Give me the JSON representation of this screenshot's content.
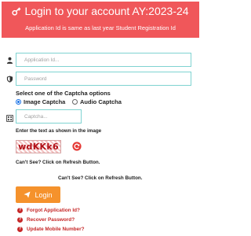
{
  "header": {
    "title": "Login to your account AY:2023-24",
    "subtitle": "Application Id is same as last year Student Registration Id",
    "icon": "key-icon",
    "background_color": "#f0575a"
  },
  "form": {
    "application_id": {
      "placeholder": "Application Id...",
      "icon": "user-icon",
      "value": ""
    },
    "password": {
      "placeholder": "Password",
      "icon": "shield-icon",
      "value": ""
    },
    "captcha_heading": "Select one of the Captcha options",
    "captcha_options": [
      {
        "label": "Image Captcha",
        "selected": true
      },
      {
        "label": "Audio Captcha",
        "selected": false
      }
    ],
    "captcha_input": {
      "placeholder": "Captcha...",
      "icon": "captcha-icon",
      "value": ""
    },
    "enter_text_label": "Enter the text as shown in the image",
    "captcha_image_text": "wdKKk6",
    "refresh_icon": "refresh-icon",
    "cant_see_1": "Can't See? Click on Refresh Button.",
    "cant_see_2": "Can't See? Click on Refresh Button.",
    "login_button": {
      "label": "Login",
      "icon": "send-icon",
      "color": "#f5922c"
    }
  },
  "help_links": [
    {
      "label": "Forgot Application Id?",
      "icon": "question-icon"
    },
    {
      "label": "Recover Password?",
      "icon": "question-icon"
    },
    {
      "label": "Update Mobile Number?",
      "icon": "question-icon"
    }
  ],
  "accent_color": "#c62828",
  "input_border_color": "#7fd3d1"
}
